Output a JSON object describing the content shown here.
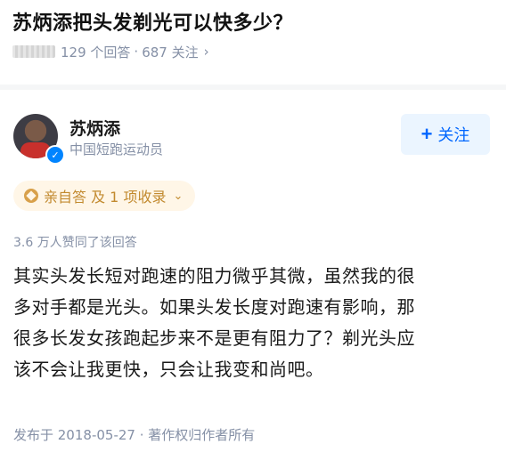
{
  "question": {
    "title": "苏炳添把头发剃光可以快多少？",
    "answer_count": "129 个回答",
    "separator": "·",
    "follow_count": "687 关注",
    "chevron": "›"
  },
  "author": {
    "name": "苏炳添",
    "description": "中国短跑运动员",
    "avatar_icon": "avatar-photo",
    "verified_icon": "verified-check-icon",
    "verified_glyph": "✓",
    "follow_plus": "+",
    "follow_label": "关注"
  },
  "badge": {
    "label": "亲自答 及 1 项收录",
    "chevron": "⌄",
    "color": "#c28a2f"
  },
  "answer": {
    "votes": "3.6 万人赞同了该回答",
    "lines": [
      "其实头发长短对跑速的阻力微乎其微，虽然我的很",
      "多对手都是光头。如果头发长度对跑速有影响，那",
      "很多长发女孩跑起步来不是更有阻力了？剃光头应",
      "该不会让我更快，只会让我变和尚吧。"
    ],
    "published": "发布于 2018-05-27 · 著作权归作者所有"
  },
  "colors": {
    "accent": "#0066ff",
    "follow_bg": "#ebf5ff",
    "meta": "#8590a6"
  }
}
